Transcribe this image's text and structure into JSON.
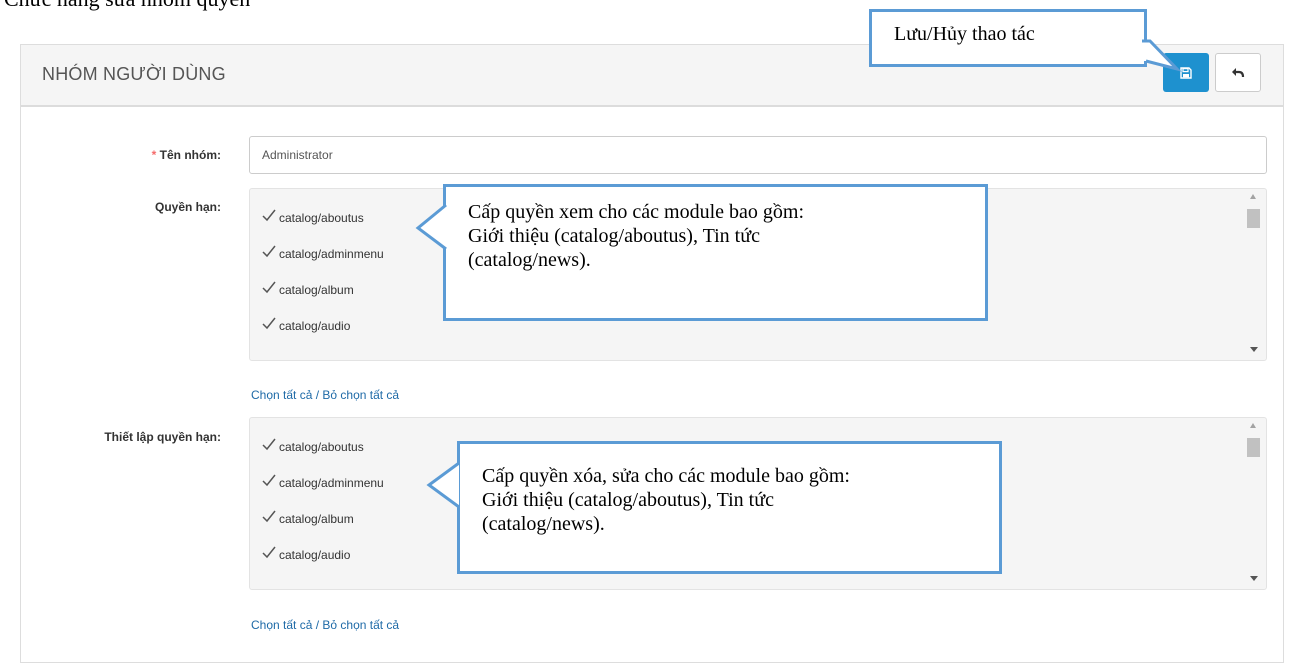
{
  "doc_heading": "Chức năng sửa nhóm quyền",
  "header": {
    "title": "NHÓM NGƯỜI DÙNG",
    "save_icon": "floppy-disk-icon",
    "back_icon": "reply-arrow-icon"
  },
  "form": {
    "group_name": {
      "label": "Tên nhóm:",
      "required_mark": "*",
      "value": "Administrator"
    },
    "view_permissions": {
      "label": "Quyền hạn:",
      "items": [
        "catalog/aboutus",
        "catalog/adminmenu",
        "catalog/album",
        "catalog/audio"
      ],
      "select_all": "Chọn tất cả",
      "separator": " / ",
      "deselect_all": "Bỏ chọn tất cả"
    },
    "modify_permissions": {
      "label": "Thiết lập quyền hạn:",
      "items": [
        "catalog/aboutus",
        "catalog/adminmenu",
        "catalog/album",
        "catalog/audio"
      ],
      "select_all": "Chọn tất cả",
      "separator": " / ",
      "deselect_all": "Bỏ chọn tất cả"
    }
  },
  "callouts": {
    "save_cancel": "Lưu/Hủy thao tác",
    "view_line1": "Cấp quyền xem cho các module bao gồm:",
    "view_line2": "Giới thiệu (catalog/aboutus), Tin tức",
    "view_line3": "(catalog/news).",
    "modify_line1": "Cấp quyền xóa, sửa cho các module bao gồm:",
    "modify_line2": "Giới thiệu (catalog/aboutus), Tin tức",
    "modify_line3": "(catalog/news)."
  },
  "colors": {
    "primary": "#1e91cf",
    "callout_border": "#5b9bd5",
    "link": "#1e6aa7",
    "required": "#f56b6b"
  }
}
